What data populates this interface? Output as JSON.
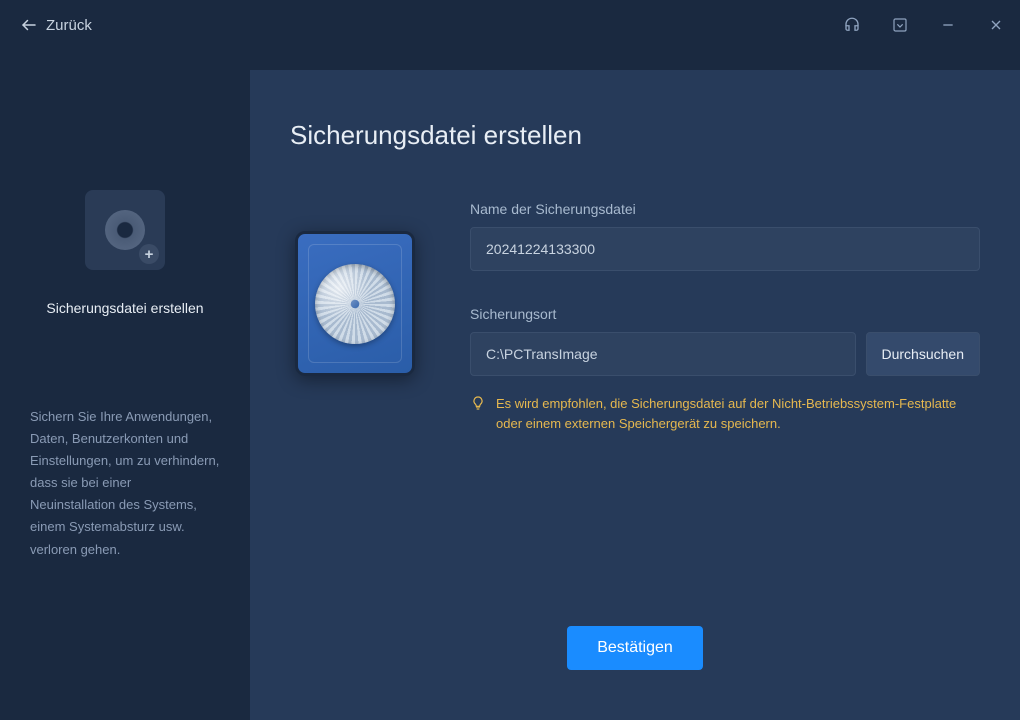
{
  "header": {
    "back_label": "Zurück"
  },
  "sidebar": {
    "title": "Sicherungsdatei erstellen",
    "description": "Sichern Sie Ihre Anwendungen, Daten, Benutzerkonten und Einstellungen, um zu verhindern, dass sie bei einer Neuinstallation des Systems, einem Systemabsturz usw. verloren gehen."
  },
  "main": {
    "title": "Sicherungsdatei erstellen",
    "backup_name": {
      "label": "Name der Sicherungsdatei",
      "value": "20241224133300"
    },
    "backup_location": {
      "label": "Sicherungsort",
      "value": "C:\\PCTransImage",
      "browse_label": "Durchsuchen"
    },
    "hint": "Es wird empfohlen, die Sicherungsdatei auf der Nicht-Betriebssystem-Festplatte oder einem externen Speichergerät zu speichern.",
    "confirm_label": "Bestätigen"
  }
}
